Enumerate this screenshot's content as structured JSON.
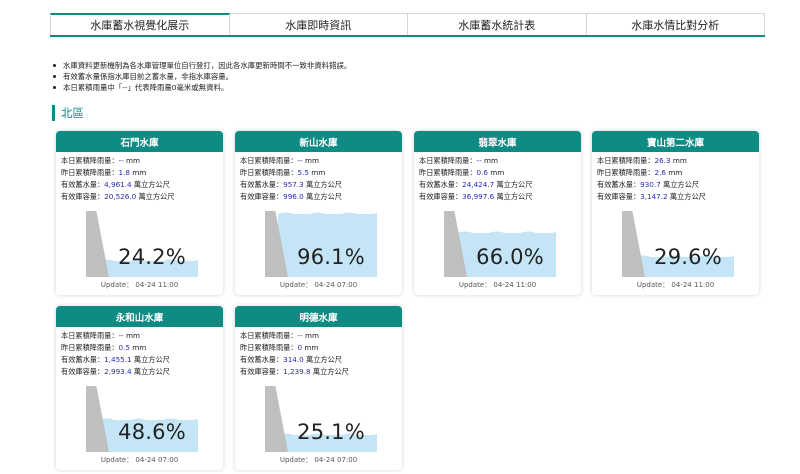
{
  "tabs": [
    {
      "label": "水庫蓄水視覺化展示"
    },
    {
      "label": "水庫即時資訊"
    },
    {
      "label": "水庫蓄水統計表"
    },
    {
      "label": "水庫水情比對分析"
    }
  ],
  "notes": [
    "水庫資料更新機制為各水庫管理單位自行登打，因此各水庫更新時間不一致非資料錯誤。",
    "有效蓄水量係指水庫目前之蓄水量，非指水庫容量。",
    "本日累積雨量中「--」代表降雨量0毫米或無資料。"
  ],
  "region": "北區",
  "labels": {
    "today_rain": "本日累積降雨量：",
    "yesterday_rain": "昨日累積降雨量：",
    "storage": "有效蓄水量：",
    "capacity": "有效庫容量：",
    "mm": "mm",
    "unit": "萬立方公尺",
    "update": "Update："
  },
  "colors": {
    "accent": "#0e8c84",
    "value_text": "#2a2ab0",
    "water": "#c3e5f6",
    "dam": "#bfbfbf"
  },
  "reservoirs": [
    {
      "name": "石門水庫",
      "today_rain": "--",
      "yesterday_rain": "1.8",
      "storage": "4,961.4",
      "capacity": "20,526.0",
      "percent": "24.2%",
      "percent_value": 24.2,
      "update_time": "04-24 11:00"
    },
    {
      "name": "新山水庫",
      "today_rain": "--",
      "yesterday_rain": "5.5",
      "storage": "957.3",
      "capacity": "996.0",
      "percent": "96.1%",
      "percent_value": 96.1,
      "update_time": "04-24 07:00"
    },
    {
      "name": "翡翠水庫",
      "today_rain": "--",
      "yesterday_rain": "0.6",
      "storage": "24,424.7",
      "capacity": "36,997.6",
      "percent": "66.0%",
      "percent_value": 66.0,
      "update_time": "04-24 11:00"
    },
    {
      "name": "寶山第二水庫",
      "today_rain": "26.3",
      "yesterday_rain": "2.6",
      "storage": "930.7",
      "capacity": "3,147.2",
      "percent": "29.6%",
      "percent_value": 29.6,
      "update_time": "04-24 11:00"
    },
    {
      "name": "永和山水庫",
      "today_rain": "--",
      "yesterday_rain": "0.5",
      "storage": "1,455.1",
      "capacity": "2,993.4",
      "percent": "48.6%",
      "percent_value": 48.6,
      "update_time": "04-24 07:00"
    },
    {
      "name": "明德水庫",
      "today_rain": "--",
      "yesterday_rain": "0",
      "storage": "314.0",
      "capacity": "1,239.8",
      "percent": "25.1%",
      "percent_value": 25.1,
      "update_time": "04-24 07:00"
    }
  ]
}
